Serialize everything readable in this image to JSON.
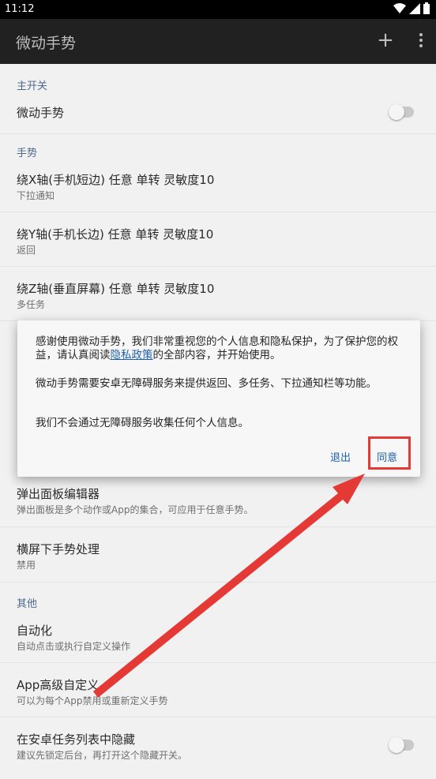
{
  "status": {
    "time": "11:12"
  },
  "appbar": {
    "title": "微动手势",
    "add_icon": "plus-icon",
    "more_icon": "more-vert-icon"
  },
  "sections": {
    "main_switch": {
      "header": "主开关",
      "item_title": "微动手势"
    },
    "gestures": {
      "header": "手势",
      "items": [
        {
          "title": "绕X轴(手机短边) 任意 单转 灵敏度10",
          "subtitle": "下拉通知"
        },
        {
          "title": "绕Y轴(手机长边) 任意 单转 灵敏度10",
          "subtitle": "返回"
        },
        {
          "title": "绕Z轴(垂直屏幕) 任意 单转 灵敏度10",
          "subtitle": "多任务"
        }
      ]
    },
    "more_items": [
      {
        "title": "弹出面板编辑器",
        "subtitle": "弹出面板是多个动作或App的集合，可应用于任意手势。"
      },
      {
        "title": "横屏下手势处理",
        "subtitle": "禁用"
      }
    ],
    "others": {
      "header": "其他",
      "items": [
        {
          "title": "自动化",
          "subtitle": "自动点击或执行自定义操作"
        },
        {
          "title": "App高级自定义",
          "subtitle": "可以为每个App禁用或重新定义手势"
        },
        {
          "title": "在安卓任务列表中隐藏",
          "subtitle": "建议先锁定后台，再打开这个隐藏开关。"
        }
      ]
    }
  },
  "dialog": {
    "p1_before": "感谢使用微动手势，我们非常重视您的个人信息和隐私保护，为了保护您的权益，请认真阅读",
    "p1_link": "隐私政策",
    "p1_after": "的全部内容，并开始使用。",
    "p2": "微动手势需要安卓无障碍服务来提供返回、多任务、下拉通知栏等功能。",
    "p3": "我们不会通过无障碍服务收集任何个人信息。",
    "exit_label": "退出",
    "agree_label": "同意"
  },
  "colors": {
    "accent": "#1e5fa8",
    "highlight": "#e53935",
    "category": "#4c6a8a"
  }
}
